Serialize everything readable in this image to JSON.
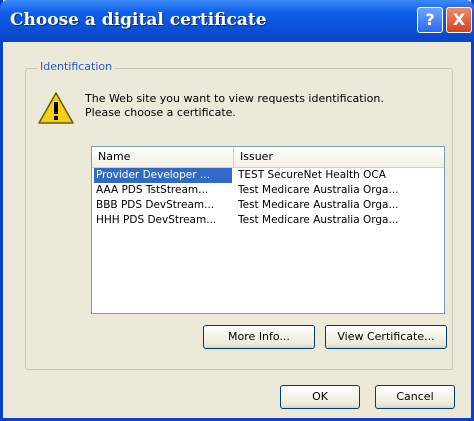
{
  "window": {
    "title": "Choose a digital certificate",
    "help_label": "?",
    "close_label": "X"
  },
  "group": {
    "label": "Identification"
  },
  "message": {
    "text": "The Web site you want to view requests identification. Please choose a certificate."
  },
  "list": {
    "columns": [
      "Name",
      "Issuer"
    ],
    "rows": [
      {
        "name": "Provider Developer ...",
        "issuer": "TEST SecureNet Health OCA",
        "selected": true
      },
      {
        "name": "AAA PDS TstStream...",
        "issuer": "Test Medicare Australia Orga...",
        "selected": false
      },
      {
        "name": "BBB PDS DevStream...",
        "issuer": "Test Medicare Australia Orga...",
        "selected": false
      },
      {
        "name": "HHH PDS DevStream...",
        "issuer": "Test Medicare Australia Orga...",
        "selected": false
      }
    ]
  },
  "buttons": {
    "more_info": "More Info...",
    "view_certificate": "View Certificate...",
    "ok": "OK",
    "cancel": "Cancel"
  },
  "colors": {
    "title_bar": "#0b4fd8",
    "selection": "#316ac5",
    "dialog_bg": "#ece9d8"
  },
  "icons": {
    "warning": "warning-icon",
    "help": "help-icon",
    "close": "close-icon"
  }
}
